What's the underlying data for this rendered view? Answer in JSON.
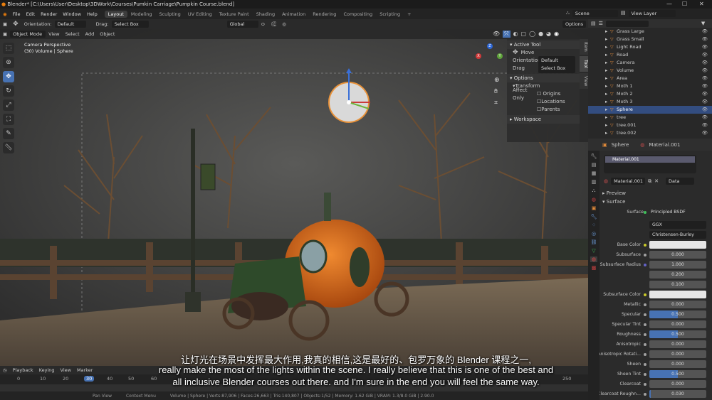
{
  "titlebar": {
    "title": "Blender* [C:\\Users\\User\\Desktop\\3DWork\\Courses\\Pumkin Carriage\\Pumpkin Course.blend]",
    "min": "—",
    "max": "☐",
    "close": "✕"
  },
  "menu": [
    "File",
    "Edit",
    "Render",
    "Window",
    "Help"
  ],
  "workspaces": [
    "Layout",
    "Modeling",
    "Sculpting",
    "UV Editing",
    "Texture Paint",
    "Shading",
    "Animation",
    "Rendering",
    "Compositing",
    "Scripting"
  ],
  "add_workspace": "+",
  "scene": "Scene",
  "view_layer": "View Layer",
  "toolheader": {
    "orientation_label": "Orientation:",
    "orientation": "Default",
    "drag_label": "Drag:",
    "drag": "Select Box",
    "transform": "Global",
    "options": "Options"
  },
  "viewport_header": {
    "mode": "Object Mode",
    "items": [
      "View",
      "Select",
      "Add",
      "Object"
    ]
  },
  "viewport": {
    "camera_label": "Camera Perspective",
    "object_label": "(30) Volume | Sphere"
  },
  "gizmo": {
    "x": "X",
    "y": "Y",
    "z": "Z"
  },
  "npanel": {
    "tabs": [
      "Item",
      "Tool",
      "View"
    ],
    "active_tool": "Active Tool",
    "move": "Move",
    "orientation_label": "Orientation",
    "orientation": "Default",
    "drag_label": "Drag",
    "drag": "Select Box",
    "options": "Options",
    "transform": "Transform",
    "affect_only": "Affect Only",
    "origins": "Origins",
    "locations": "Locations",
    "parents": "Parents",
    "workspace": "Workspace"
  },
  "outliner": {
    "items": [
      {
        "name": "Grass Large",
        "selected": false
      },
      {
        "name": "Grass Small",
        "selected": false
      },
      {
        "name": "Light Road",
        "selected": false
      },
      {
        "name": "Road",
        "selected": false
      },
      {
        "name": "Camera",
        "selected": false
      },
      {
        "name": "Volume",
        "selected": false
      },
      {
        "name": "Area",
        "selected": false
      },
      {
        "name": "Moth 1",
        "selected": false
      },
      {
        "name": "Moth 2",
        "selected": false
      },
      {
        "name": "Moth 3",
        "selected": false
      },
      {
        "name": "Sphere",
        "selected": true
      },
      {
        "name": "tree",
        "selected": false
      },
      {
        "name": "tree.001",
        "selected": false
      },
      {
        "name": "tree.002",
        "selected": false
      }
    ]
  },
  "properties": {
    "breadcrumb_object": "Sphere",
    "breadcrumb_material": "Material.001",
    "slot": "Material.001",
    "material_name": "Material.001",
    "link": "Data",
    "preview": "Preview",
    "surface_section": "Surface",
    "surface_label": "Surface",
    "surface_value": "Principled BSDF",
    "distribution": "GGX",
    "sss_method": "Christensen-Burley",
    "rows": [
      {
        "label": "Base Color",
        "value": "",
        "fill": 0,
        "color": "#e6e6e6"
      },
      {
        "label": "Subsurface",
        "value": "0.000",
        "fill": 0
      },
      {
        "label": "Subsurface Radius",
        "value": "1.000",
        "fill": 0
      },
      {
        "label": "",
        "value": "0.200",
        "fill": 0
      },
      {
        "label": "",
        "value": "0.100",
        "fill": 0
      },
      {
        "label": "Subsurface Color",
        "value": "",
        "fill": 0,
        "color": "#e6e6e6"
      },
      {
        "label": "Metallic",
        "value": "0.000",
        "fill": 0
      },
      {
        "label": "Specular",
        "value": "0.500",
        "fill": 0.5
      },
      {
        "label": "Specular Tint",
        "value": "0.000",
        "fill": 0
      },
      {
        "label": "Roughness",
        "value": "0.500",
        "fill": 0.5
      },
      {
        "label": "Anisotropic",
        "value": "0.000",
        "fill": 0
      },
      {
        "label": "Anisotropic Rotati...",
        "value": "0.000",
        "fill": 0
      },
      {
        "label": "Sheen",
        "value": "0.000",
        "fill": 0
      },
      {
        "label": "Sheen Tint",
        "value": "0.500",
        "fill": 0.5
      },
      {
        "label": "Clearcoat",
        "value": "0.000",
        "fill": 0
      },
      {
        "label": "Clearcoat Roughn...",
        "value": "0.030",
        "fill": 0.03
      }
    ]
  },
  "timeline": {
    "items": [
      "Playback",
      "Keying",
      "View",
      "Marker"
    ],
    "ticks": [
      "0",
      "10",
      "20",
      "30",
      "40",
      "50",
      "60",
      "250"
    ],
    "current_frame": "30",
    "status_left": "Pan View",
    "status_mid": "Context Menu",
    "status_right": "Volume | Sphere | Verts:87,906 | Faces:26,663 | Tris:140,807 | Objects:1/52 | Memory: 1.62 GiB | VRAM: 1.3/8.0 GiB | 2.90.0"
  },
  "subtitles": {
    "zh": "让灯光在场景中发挥最大作用,我真的相信,这是最好的、包罗万象的 Blender 课程之一,",
    "en1": "really make the most of the lights within the scene. I really believe that this is one of the best and",
    "en2": "all inclusive Blender courses out there. and I'm sure in the end you will feel the same way."
  },
  "colors": {
    "accent": "#4772b3",
    "selected": "#334d80",
    "pumpkin": "#d9691e",
    "bg": "#1d1d1d"
  }
}
